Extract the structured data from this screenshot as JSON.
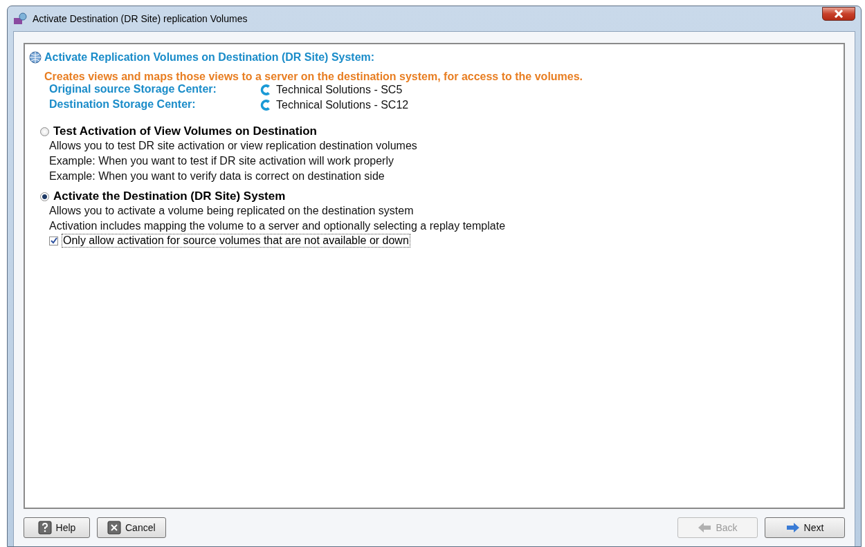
{
  "window": {
    "title": "Activate Destination (DR Site) replication Volumes"
  },
  "header": {
    "title": "Activate Replication Volumes on Destination (DR Site) System:",
    "description": "Creates views and maps those views to a server on the destination system, for access to the volumes.",
    "details": [
      {
        "label": "Original source Storage Center:",
        "value": "Technical Solutions - SC5"
      },
      {
        "label": "Destination Storage Center:",
        "value": "Technical Solutions - SC12"
      }
    ]
  },
  "options": [
    {
      "label": "Test Activation of View Volumes on Destination",
      "selected": false,
      "lines": [
        "Allows you to test DR site activation or view replication destination volumes",
        "Example: When you want to test if DR site activation will work properly",
        "Example: When you want to verify data is correct on destination side"
      ]
    },
    {
      "label": "Activate the Destination (DR Site) System",
      "selected": true,
      "lines": [
        "Allows you to activate a volume being replicated on the destination system",
        "Activation includes mapping the volume to a server and optionally selecting a replay template"
      ],
      "checkbox": {
        "label": "Only allow activation for source volumes that are not available or down",
        "checked": true
      }
    }
  ],
  "buttons": [
    {
      "label": "Help",
      "kind": "help",
      "disabled": false
    },
    {
      "label": "Cancel",
      "kind": "cancel",
      "disabled": false
    },
    {
      "label": "Back",
      "kind": "back",
      "disabled": true
    },
    {
      "label": "Next",
      "kind": "next",
      "disabled": false
    }
  ]
}
